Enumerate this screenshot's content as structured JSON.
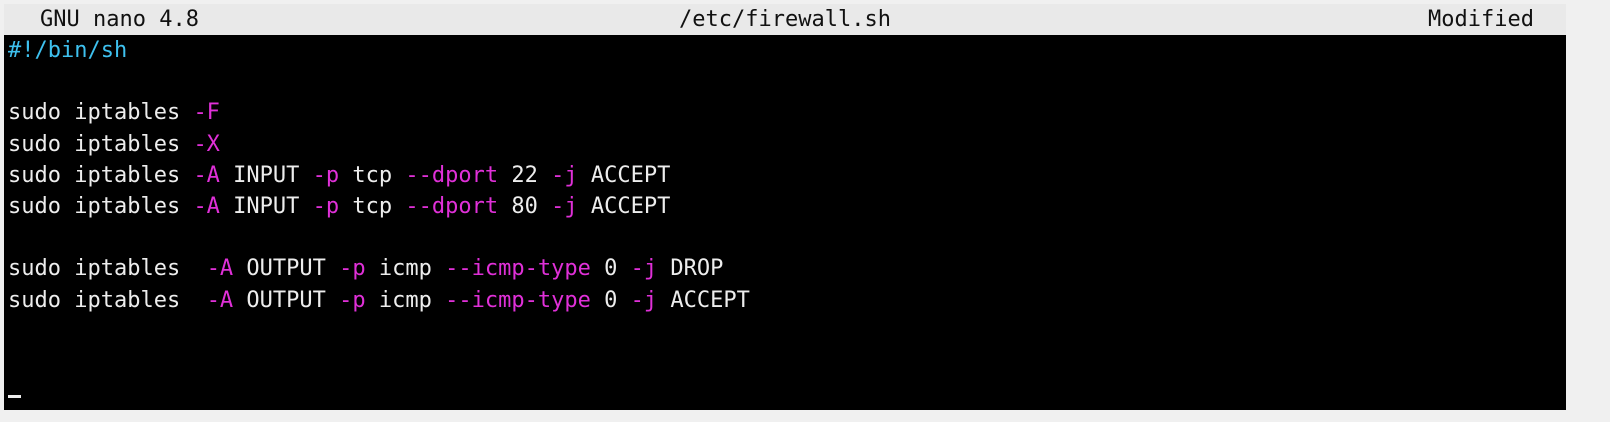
{
  "titlebar": {
    "app": "GNU nano 4.8",
    "file": "/etc/firewall.sh",
    "status": "Modified"
  },
  "colors": {
    "titlebar_bg": "#e9e9e9",
    "editor_bg": "#000000",
    "text": "#ededed",
    "comment": "#3ec1ef",
    "flag": "#e030d8"
  },
  "lines": [
    [
      {
        "t": "#!/bin/sh",
        "c": "comment"
      }
    ],
    [],
    [
      {
        "t": "sudo iptables ",
        "c": "plain"
      },
      {
        "t": "-F",
        "c": "flag"
      }
    ],
    [
      {
        "t": "sudo iptables ",
        "c": "plain"
      },
      {
        "t": "-X",
        "c": "flag"
      }
    ],
    [
      {
        "t": "sudo iptables ",
        "c": "plain"
      },
      {
        "t": "-A",
        "c": "flag"
      },
      {
        "t": " INPUT ",
        "c": "plain"
      },
      {
        "t": "-p",
        "c": "flag"
      },
      {
        "t": " tcp ",
        "c": "plain"
      },
      {
        "t": "--dport",
        "c": "flag"
      },
      {
        "t": " 22 ",
        "c": "plain"
      },
      {
        "t": "-j",
        "c": "flag"
      },
      {
        "t": " ACCEPT",
        "c": "plain"
      }
    ],
    [
      {
        "t": "sudo iptables ",
        "c": "plain"
      },
      {
        "t": "-A",
        "c": "flag"
      },
      {
        "t": " INPUT ",
        "c": "plain"
      },
      {
        "t": "-p",
        "c": "flag"
      },
      {
        "t": " tcp ",
        "c": "plain"
      },
      {
        "t": "--dport",
        "c": "flag"
      },
      {
        "t": " 80 ",
        "c": "plain"
      },
      {
        "t": "-j",
        "c": "flag"
      },
      {
        "t": " ACCEPT",
        "c": "plain"
      }
    ],
    [],
    [
      {
        "t": "sudo iptables  ",
        "c": "plain"
      },
      {
        "t": "-A",
        "c": "flag"
      },
      {
        "t": " OUTPUT ",
        "c": "plain"
      },
      {
        "t": "-p",
        "c": "flag"
      },
      {
        "t": " icmp ",
        "c": "plain"
      },
      {
        "t": "--icmp-type",
        "c": "flag"
      },
      {
        "t": " 0 ",
        "c": "plain"
      },
      {
        "t": "-j",
        "c": "flag"
      },
      {
        "t": " DROP",
        "c": "plain"
      }
    ],
    [
      {
        "t": "sudo iptables  ",
        "c": "plain"
      },
      {
        "t": "-A",
        "c": "flag"
      },
      {
        "t": " OUTPUT ",
        "c": "plain"
      },
      {
        "t": "-p",
        "c": "flag"
      },
      {
        "t": " icmp ",
        "c": "plain"
      },
      {
        "t": "--icmp-type",
        "c": "flag"
      },
      {
        "t": " 0 ",
        "c": "plain"
      },
      {
        "t": "-j",
        "c": "flag"
      },
      {
        "t": " ACCEPT",
        "c": "plain"
      }
    ],
    [],
    [],
    []
  ],
  "cursor": {
    "line": 12,
    "column": 1
  }
}
